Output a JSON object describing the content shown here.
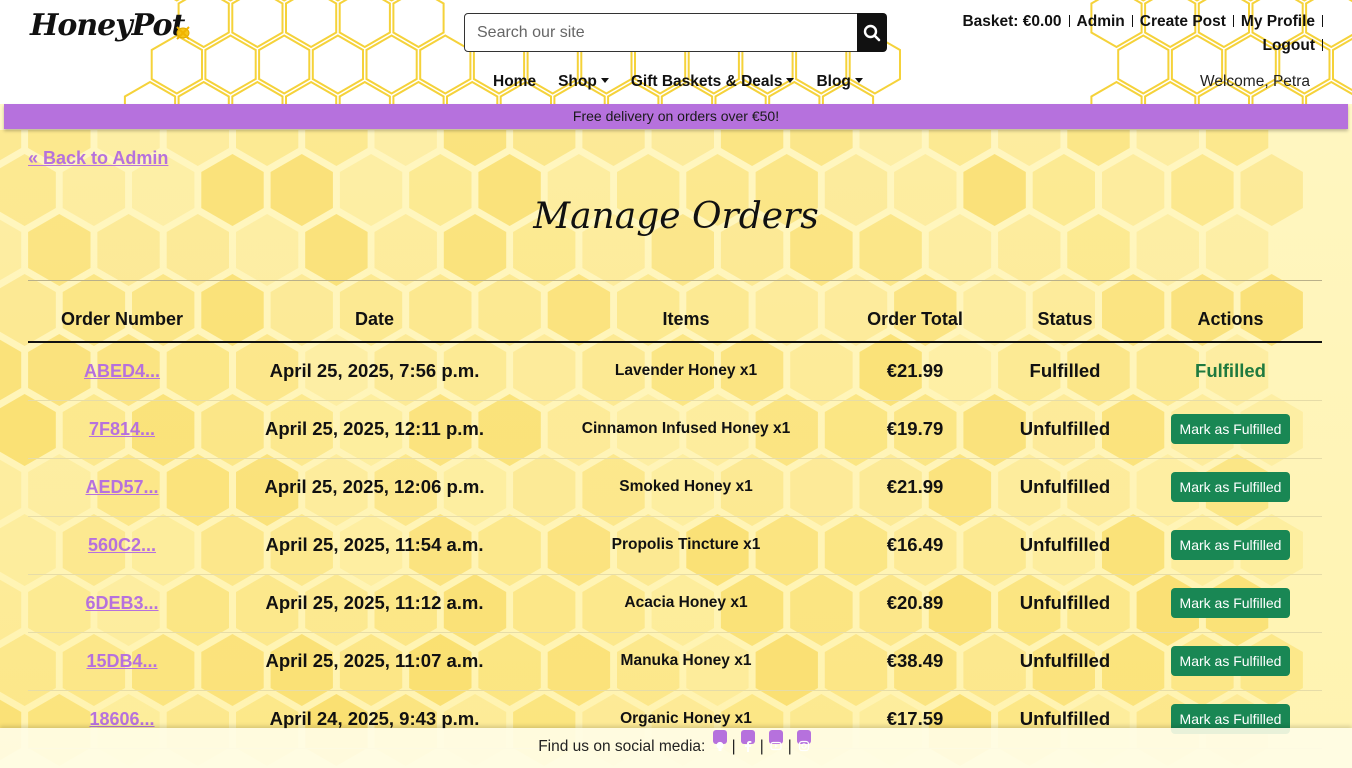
{
  "header": {
    "logo_text": "HoneyPot",
    "search_placeholder": "Search our site",
    "top_links": {
      "basket": "Basket: €0.00",
      "admin": "Admin",
      "create_post": "Create Post",
      "my_profile": "My Profile",
      "logout": "Logout"
    },
    "nav": {
      "home": "Home",
      "shop": "Shop",
      "gift_baskets": "Gift Baskets & Deals",
      "blog": "Blog"
    },
    "welcome": "Welcome, Petra"
  },
  "promo": "Free delivery on orders over €50!",
  "colors": {
    "accent": "#b671dd",
    "honey": "#f5d23a",
    "success": "#198754"
  },
  "main": {
    "back_link": "« Back to Admin",
    "title": "Manage Orders",
    "table": {
      "headers": [
        "Order Number",
        "Date",
        "Items",
        "Order Total",
        "Status",
        "Actions"
      ],
      "rows": [
        {
          "order": "ABED4...",
          "date": "April 25, 2025, 7:56 p.m.",
          "items": "Lavender Honey x1",
          "total": "€21.99",
          "status": "Fulfilled",
          "action": "Fulfilled"
        },
        {
          "order": "7F814...",
          "date": "April 25, 2025, 12:11 p.m.",
          "items": "Cinnamon Infused Honey x1",
          "total": "€19.79",
          "status": "Unfulfilled",
          "action": "Mark as Fulfilled"
        },
        {
          "order": "AED57...",
          "date": "April 25, 2025, 12:06 p.m.",
          "items": "Smoked Honey x1",
          "total": "€21.99",
          "status": "Unfulfilled",
          "action": "Mark as Fulfilled"
        },
        {
          "order": "560C2...",
          "date": "April 25, 2025, 11:54 a.m.",
          "items": "Propolis Tincture x1",
          "total": "€16.49",
          "status": "Unfulfilled",
          "action": "Mark as Fulfilled"
        },
        {
          "order": "6DEB3...",
          "date": "April 25, 2025, 11:12 a.m.",
          "items": "Acacia Honey x1",
          "total": "€20.89",
          "status": "Unfulfilled",
          "action": "Mark as Fulfilled"
        },
        {
          "order": "15DB4...",
          "date": "April 25, 2025, 11:07 a.m.",
          "items": "Manuka Honey x1",
          "total": "€38.49",
          "status": "Unfulfilled",
          "action": "Mark as Fulfilled"
        },
        {
          "order": "18606...",
          "date": "April 24, 2025, 9:43 p.m.",
          "items": "Organic Honey x1",
          "total": "€17.59",
          "status": "Unfulfilled",
          "action": "Mark as Fulfilled"
        }
      ]
    }
  },
  "footer": {
    "text": "Find us on social media:",
    "icons": [
      "github-icon",
      "facebook-icon",
      "youtube-icon",
      "instagram-icon"
    ]
  }
}
